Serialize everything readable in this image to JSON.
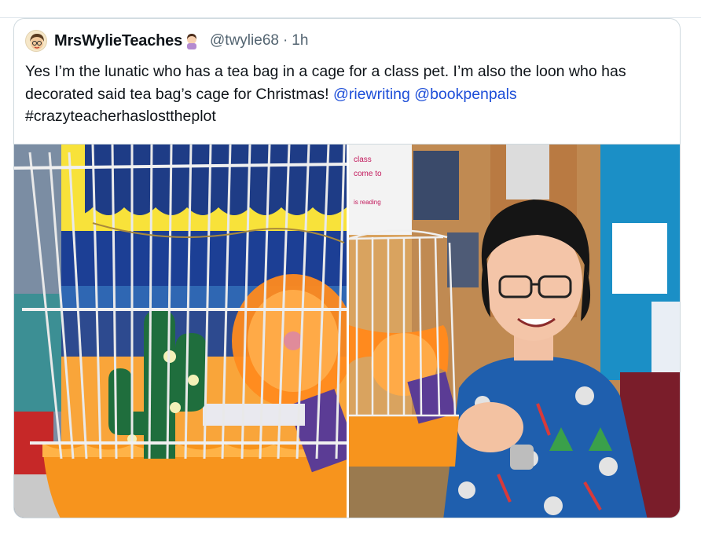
{
  "tweet": {
    "display_name": "MrsWylieTeaches",
    "handle": "@twylie68",
    "separator": "·",
    "time": "1h",
    "text_parts": {
      "line_a": "Yes I’m the lunatic who has a tea bag in a cage for a class pet. I’m also the loon who has decorated said tea bag’s cage for Christmas! ",
      "mention1": "@riewriting",
      "space": " ",
      "mention2": "@bookpenpals",
      "hashtag": "#crazyteacherhaslosttheplot"
    }
  },
  "media": {
    "photo_left_alt": "hamster-cage-photo",
    "photo_right_alt": "teacher-holding-cage-photo",
    "poster_text_1": "class",
    "poster_text_2": "come to",
    "poster_text_3": "is reading"
  },
  "colors": {
    "link": "#1d4ed8",
    "cage_orange": "#f7941d",
    "text_primary": "#0f1419",
    "text_secondary": "#536471"
  }
}
